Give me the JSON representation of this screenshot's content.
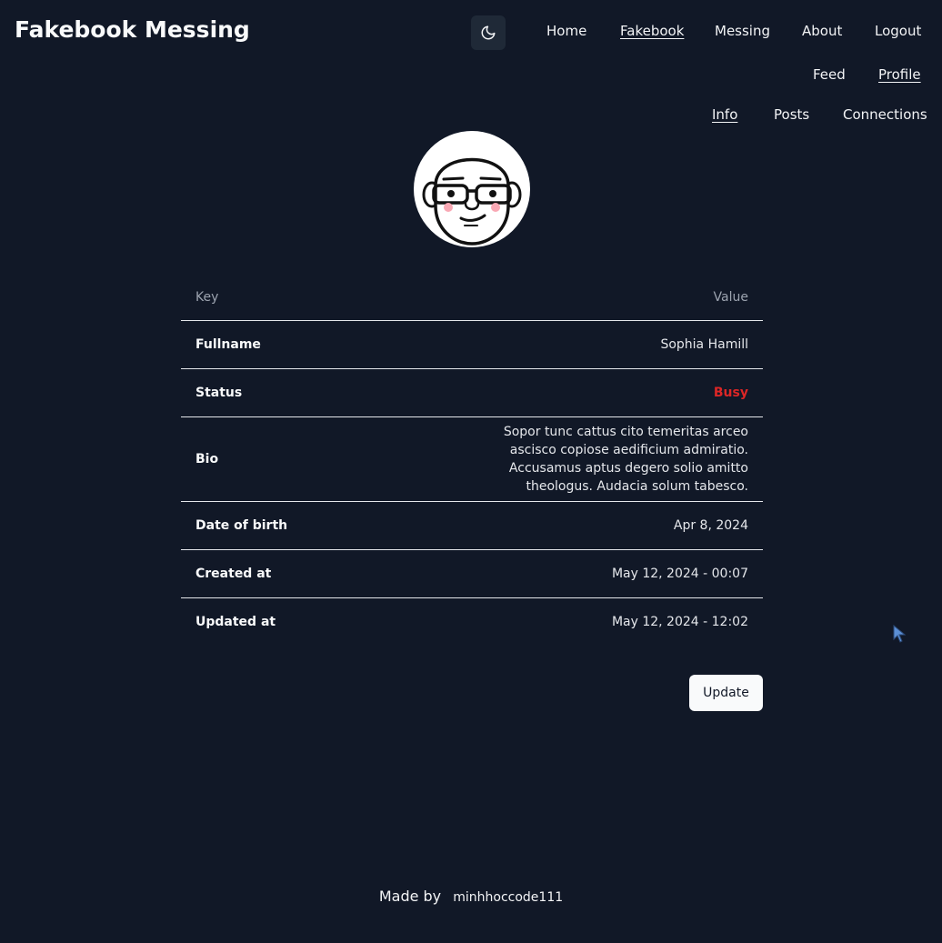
{
  "app": {
    "title": "Fakebook Messing"
  },
  "nav": {
    "primary": [
      {
        "label": "Home",
        "active": false
      },
      {
        "label": "Fakebook",
        "active": true
      },
      {
        "label": "Messing",
        "active": false
      },
      {
        "label": "About",
        "active": false
      },
      {
        "label": "Logout",
        "active": false
      }
    ],
    "secondary": [
      {
        "label": "Feed",
        "active": false
      },
      {
        "label": "Profile",
        "active": true
      }
    ],
    "tertiary": [
      {
        "label": "Info",
        "active": true
      },
      {
        "label": "Posts",
        "active": false
      },
      {
        "label": "Connections",
        "active": false
      }
    ],
    "theme_icon": "moon-icon"
  },
  "profile": {
    "avatar_icon": "bald-man-with-glasses-avatar",
    "table": {
      "headers": {
        "key": "Key",
        "value": "Value"
      },
      "rows": [
        {
          "key": "Fullname",
          "value": "Sophia Hamill"
        },
        {
          "key": "Status",
          "value": "Busy"
        },
        {
          "key": "Bio",
          "value": "Sopor tunc cattus cito temeritas arceo ascisco copiose aedificium admiratio. Accusamus aptus degero solio amitto theologus. Audacia solum tabesco."
        },
        {
          "key": "Date of birth",
          "value": "Apr 8, 2024"
        },
        {
          "key": "Created at",
          "value": "May 12, 2024 - 00:07"
        },
        {
          "key": "Updated at",
          "value": "May 12, 2024 - 12:02"
        }
      ]
    },
    "update_label": "Update"
  },
  "footer": {
    "prefix": "Made by",
    "author": "minhhoccode111"
  },
  "colors": {
    "background": "#111827",
    "status_busy": "#dc2626",
    "button_bg": "#f9fafb"
  }
}
